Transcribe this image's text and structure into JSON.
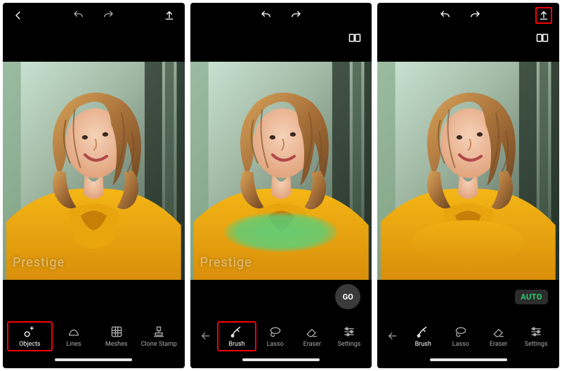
{
  "watermark_text": "Prestige",
  "screens": {
    "s1": {
      "undo_enabled": false,
      "redo_enabled": false,
      "show_compare": false,
      "export_highlight": false,
      "overlay": "none",
      "action_row": "none",
      "toolbar_kind": "main",
      "back_in_toolbar": false,
      "highlight_tool_index": 0
    },
    "s2": {
      "undo_enabled": true,
      "redo_enabled": true,
      "show_compare": true,
      "export_highlight": false,
      "overlay": "brush",
      "action_row": "go",
      "toolbar_kind": "brush",
      "back_in_toolbar": true,
      "highlight_tool_index": 0
    },
    "s3": {
      "undo_enabled": true,
      "redo_enabled": true,
      "show_compare": true,
      "export_highlight": true,
      "overlay": "removed",
      "action_row": "auto",
      "toolbar_kind": "brush",
      "back_in_toolbar": true,
      "highlight_tool_index": -1
    }
  },
  "toolbars": {
    "main": [
      {
        "id": "objects",
        "label": "Objects",
        "icon": "sparkle"
      },
      {
        "id": "lines",
        "label": "Lines",
        "icon": "lines"
      },
      {
        "id": "meshes",
        "label": "Meshes",
        "icon": "mesh"
      },
      {
        "id": "clone-stamp",
        "label": "Clone Stamp",
        "icon": "stamp"
      }
    ],
    "brush": [
      {
        "id": "brush",
        "label": "Brush",
        "icon": "brush"
      },
      {
        "id": "lasso",
        "label": "Lasso",
        "icon": "lasso"
      },
      {
        "id": "eraser",
        "label": "Eraser",
        "icon": "eraser"
      },
      {
        "id": "settings",
        "label": "Settings",
        "icon": "sliders"
      }
    ]
  },
  "buttons": {
    "go": "GO",
    "auto": "AUTO"
  }
}
